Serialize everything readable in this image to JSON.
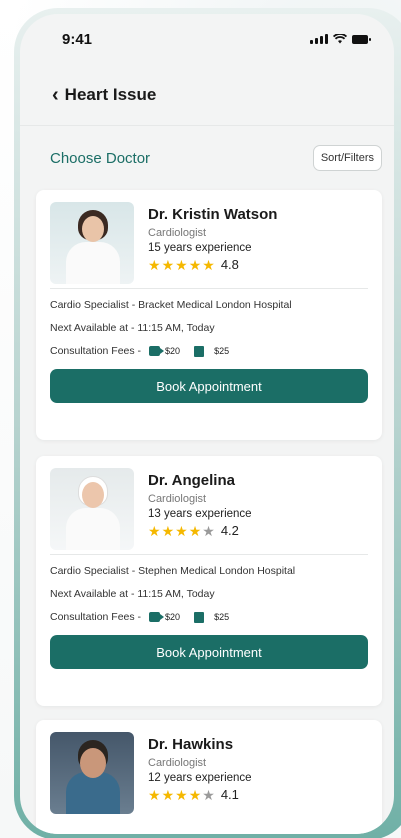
{
  "status": {
    "time": "9:41"
  },
  "header": {
    "title": "Heart Issue"
  },
  "section": {
    "title": "Choose Doctor",
    "sort_label": "Sort/Filters"
  },
  "doctors": [
    {
      "name": "Dr. Kristin Watson",
      "specialty": "Cardiologist",
      "experience": "15 years experience",
      "stars_filled": 5,
      "rating": "4.8",
      "hospital": "Cardio Specialist - Bracket Medical London Hospital",
      "availability": "Next Available at - 11:15 AM, Today",
      "fees_label": "Consultation Fees -",
      "video_fee": "$20",
      "clinic_fee": "$25",
      "button": "Book Appointment"
    },
    {
      "name": "Dr. Angelina",
      "specialty": "Cardiologist",
      "experience": "13 years experience",
      "stars_filled": 4,
      "rating": "4.2",
      "hospital": "Cardio Specialist - Stephen Medical London Hospital",
      "availability": "Next Available at - 11:15 AM, Today",
      "fees_label": "Consultation Fees -",
      "video_fee": "$20",
      "clinic_fee": "$25",
      "button": "Book Appointment"
    },
    {
      "name": "Dr. Hawkins",
      "specialty": "Cardiologist",
      "experience": "12 years experience",
      "stars_filled": 4,
      "rating": "4.1"
    }
  ],
  "colors": {
    "accent": "#1b6e66",
    "star": "#f5b800"
  }
}
